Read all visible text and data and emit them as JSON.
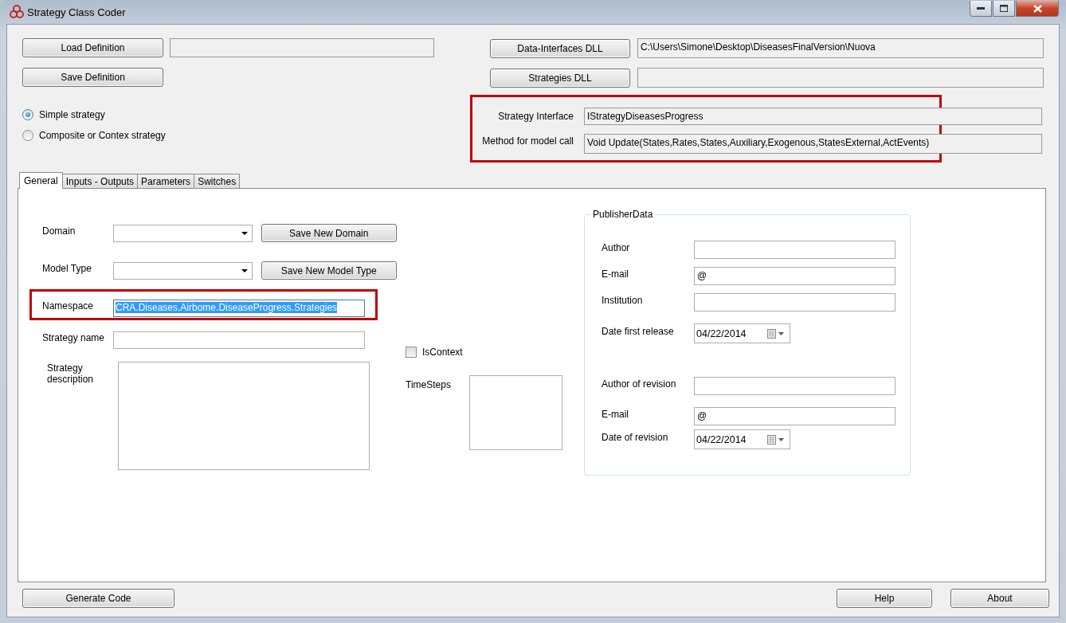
{
  "window": {
    "title": "Strategy Class Coder"
  },
  "definition": {
    "load_button": "Load Definition",
    "save_button": "Save Definition"
  },
  "strategy_type": [
    {
      "label": "Simple strategy",
      "selected": true
    },
    {
      "label": "Composite or Contex strategy",
      "selected": false
    }
  ],
  "dll": [
    {
      "button": "Data-Interfaces DLL",
      "value": "C:\\Users\\Simone\\Desktop\\DiseasesFinalVersion\\Nuova"
    },
    {
      "button": "Strategies DLL"
    }
  ],
  "interface": [
    {
      "label": "Strategy Interface",
      "value": "IStrategyDiseasesProgress"
    },
    {
      "label": "Method for model call",
      "value": "Void Update(States,Rates,States,Auxiliary,Exogenous,StatesExternal,ActEvents)"
    }
  ],
  "tabs": [
    {
      "label": "General",
      "selected": true
    },
    {
      "label": "Inputs - Outputs",
      "selected": false
    },
    {
      "label": "Parameters",
      "selected": false
    },
    {
      "label": "Switches",
      "selected": false
    }
  ],
  "general": {
    "domain": {
      "label": "Domain",
      "button": "Save New Domain"
    },
    "model_type": {
      "label": "Model Type",
      "button": "Save New Model Type"
    },
    "namespace": {
      "label": "Namespace",
      "value": "CRA.Diseases.Airbome.DiseaseProgress.Strategies",
      "text_selected": true
    },
    "strategy_name": {
      "label": "Strategy name"
    },
    "description": {
      "label": "Strategy description"
    },
    "is_context": {
      "label": "IsContext",
      "checked": false
    },
    "time_steps": {
      "label": "TimeSteps"
    }
  },
  "publisher": {
    "title": "PublisherData",
    "fields": [
      {
        "kind": "text",
        "label": "Author"
      },
      {
        "kind": "text",
        "label": "E-mail",
        "value": "@"
      },
      {
        "kind": "text",
        "label": "Institution"
      },
      {
        "kind": "date",
        "label": "Date first release",
        "value": "04/22/2014"
      },
      {
        "kind": "text",
        "label": "Author of revision"
      },
      {
        "kind": "text",
        "label": "E-mail",
        "value": "@"
      },
      {
        "kind": "date",
        "label": "Date of revision",
        "value": "04/22/2014"
      }
    ]
  },
  "footer": {
    "generate_button": "Generate Code",
    "help_button": "Help",
    "about_button": "About"
  }
}
